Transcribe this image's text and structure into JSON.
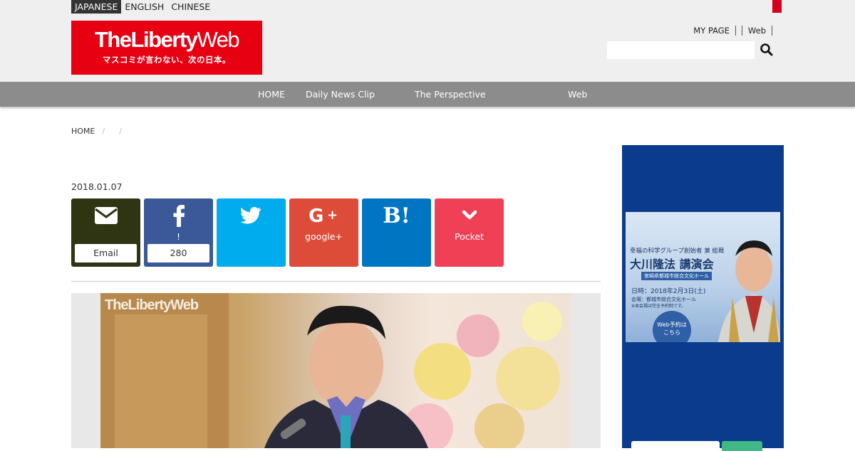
{
  "lang_switch": [
    "JAPANESE",
    "ENGLISH",
    "CHINESE"
  ],
  "logo": {
    "brand_bold": "TheLiberty",
    "brand_thin": "Web",
    "tagline": "マスコミが言わない、次の日本。"
  },
  "header_links": [
    "MY PAGE",
    "Web"
  ],
  "search": {
    "placeholder": ""
  },
  "nav": [
    "HOME",
    "Daily News Clip",
    "The Perspective",
    "Web"
  ],
  "breadcrumb": {
    "home": "HOME",
    "sep": "/"
  },
  "article": {
    "date": "2018.01.07"
  },
  "share": {
    "email_label": "Email",
    "facebook_label": "!",
    "facebook_count": "280",
    "gplus_label": "google+",
    "hatena_mark": "B!",
    "pocket_label": "Pocket"
  },
  "photo": {
    "watermark": "TheLibertyWeb"
  },
  "banner": {
    "line1": "幸福の科学グループ創始者 兼 総裁",
    "title": "大川隆法 講演会",
    "venue": "宮崎県都城市総合文化ホール",
    "date": "日時：2018年2月3日(土)",
    "place": "会場：都城市総合文化ホール",
    "note": "※本会場は完全予約制です。",
    "cta_line1": "Web予約は",
    "cta_line2": "こちら"
  },
  "colors": {
    "brand_red": "#e60012",
    "nav_gray": "#8c8c8c",
    "sidebar_blue": "#0a3b8c",
    "facebook": "#3b5998",
    "twitter": "#00aced",
    "gplus": "#dd4b39",
    "hatena": "#0075c2",
    "pocket": "#ef4056"
  },
  "icons": [
    "search-icon",
    "envelope-icon",
    "facebook-icon",
    "twitter-icon",
    "google-plus-icon",
    "hatena-icon",
    "pocket-icon"
  ]
}
